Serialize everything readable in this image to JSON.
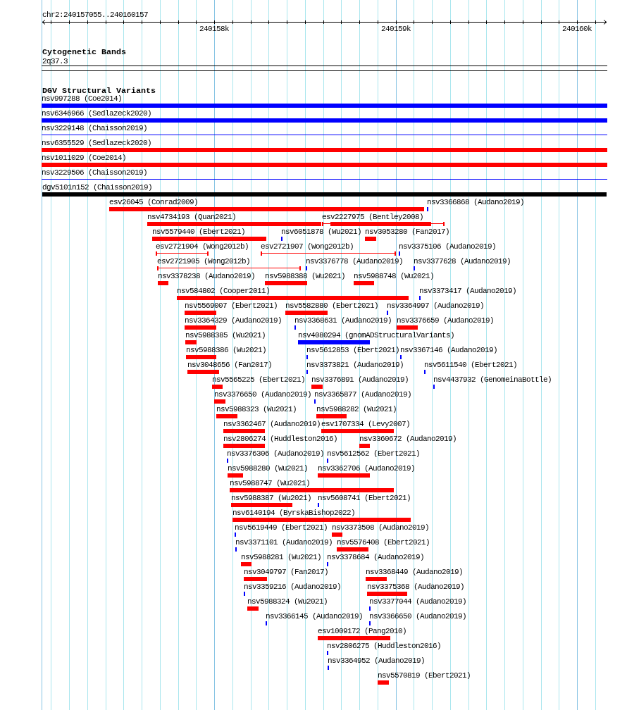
{
  "ruler": {
    "location": "chr2:240157055..240160157",
    "tick_labels": [
      "240158k",
      "240159k",
      "240160k"
    ]
  },
  "cytogenetic_bands": {
    "title": "Cytogenetic Bands",
    "band": "2q37.3"
  },
  "dgv": {
    "title": "DGV Structural Variants",
    "rows": [
      [
        {
          "label": "nsv997288 (Coe2014)",
          "kind": "bar",
          "color": "#0000ff"
        }
      ],
      [
        {
          "label": "nsv6346966 (Sedlazeck2020)",
          "kind": "bar",
          "color": "#0000ff"
        }
      ],
      [
        {
          "label": "nsv3229148 (Chaisson2019)",
          "kind": "line",
          "color": "#0000ff"
        }
      ],
      [
        {
          "label": "nsv6355529 (Sedlazeck2020)",
          "kind": "bar",
          "color": "#ff0000"
        }
      ],
      [
        {
          "label": "nsv1011029 (Coe2014)",
          "kind": "bar",
          "color": "#ff0000"
        }
      ],
      [
        {
          "label": "nsv3229506 (Chaisson2019)",
          "kind": "line",
          "color": "#0000ff"
        }
      ],
      [
        {
          "label": "dgv5101n152 (Chaisson2019)",
          "kind": "bar",
          "color": "#000000"
        }
      ],
      [
        {
          "label": "esv26045 (Conrad2009)",
          "kind": "bar",
          "color": "#ff0000"
        },
        {
          "label": "nsv3366868 (Audano2019)",
          "kind": "bar",
          "color": "#0000ff"
        }
      ],
      [
        {
          "label": "nsv4734193 (Quan2021)",
          "kind": "bar",
          "color": "#ff0000"
        },
        {
          "label": "esv2227975 (Bentley2008)",
          "kind": "mixed",
          "color": "#ff0000"
        }
      ],
      [
        {
          "label": "nsv5579440 (Ebert2021)",
          "kind": "bar",
          "color": "#ff0000"
        },
        {
          "label": "nsv6051878 (Wu2021)",
          "kind": "bar",
          "color": "#0000ff"
        },
        {
          "label": "nsv3053280 (Fan2017)",
          "kind": "bar",
          "color": "#ff0000"
        }
      ],
      [
        {
          "label": "esv2721904 (Wong2012b)",
          "kind": "interval",
          "color": "#ff0000"
        },
        {
          "label": "esv2721907 (Wong2012b)",
          "kind": "interval",
          "color": "#ff0000"
        },
        {
          "label": "nsv3375106 (Audano2019)",
          "kind": "bar",
          "color": "#0000ff"
        }
      ],
      [
        {
          "label": "esv2721905 (Wong2012b)",
          "kind": "interval",
          "color": "#ff0000"
        },
        {
          "label": "nsv3376778 (Audano2019)",
          "kind": "bar",
          "color": "#0000ff"
        },
        {
          "label": "nsv3377628 (Audano2019)",
          "kind": "bar",
          "color": "#0000ff"
        }
      ],
      [
        {
          "label": "nsv3378238 (Audano2019)",
          "kind": "bar",
          "color": "#ff0000"
        },
        {
          "label": "nsv5988388 (Wu2021)",
          "kind": "bar",
          "color": "#ff0000"
        },
        {
          "label": "nsv5988748 (Wu2021)",
          "kind": "bar",
          "color": "#ff0000"
        }
      ],
      [
        {
          "label": "nsv584802 (Cooper2011)",
          "kind": "bar",
          "color": "#ff0000"
        },
        {
          "label": "nsv3373417 (Audano2019)",
          "kind": "bar",
          "color": "#0000ff"
        }
      ],
      [
        {
          "label": "nsv5569007 (Ebert2021)",
          "kind": "bar",
          "color": "#ff0000"
        },
        {
          "label": "nsv5582880 (Ebert2021)",
          "kind": "bar",
          "color": "#ff0000"
        },
        {
          "label": "nsv3364997 (Audano2019)",
          "kind": "bar",
          "color": "#0000ff"
        }
      ],
      [
        {
          "label": "nsv3364329 (Audano2019)",
          "kind": "bar",
          "color": "#ff0000"
        },
        {
          "label": "nsv3368631 (Audano2019)",
          "kind": "bar",
          "color": "#0000ff"
        },
        {
          "label": "nsv3376659 (Audano2019)",
          "kind": "bar",
          "color": "#ff0000"
        }
      ],
      [
        {
          "label": "nsv5988385 (Wu2021)",
          "kind": "bar",
          "color": "#ff0000"
        },
        {
          "label": "nsv4080294 (gnomADStructuralVariants)",
          "kind": "bar",
          "color": "#0000ff"
        }
      ],
      [
        {
          "label": "nsv5988386 (Wu2021)",
          "kind": "bar",
          "color": "#ff0000"
        },
        {
          "label": "nsv5612853 (Ebert2021)",
          "kind": "bar",
          "color": "#0000ff"
        },
        {
          "label": "nsv3367146 (Audano2019)",
          "kind": "bar",
          "color": "#0000ff"
        }
      ],
      [
        {
          "label": "nsv3048656 (Fan2017)",
          "kind": "bar",
          "color": "#ff0000"
        },
        {
          "label": "nsv3373821 (Audano2019)",
          "kind": "bar",
          "color": "#0000ff"
        },
        {
          "label": "nsv5611540 (Ebert2021)",
          "kind": "bar",
          "color": "#0000ff"
        }
      ],
      [
        {
          "label": "nsv5565225 (Ebert2021)",
          "kind": "bar",
          "color": "#ff0000"
        },
        {
          "label": "nsv3376891 (Audano2019)",
          "kind": "bar",
          "color": "#ff0000"
        },
        {
          "label": "nsv4437932 (GenomeinaBottle)",
          "kind": "bar",
          "color": "#0000ff"
        }
      ],
      [
        {
          "label": "nsv3376650 (Audano2019)",
          "kind": "bar",
          "color": "#ff0000"
        },
        {
          "label": "nsv3365877 (Audano2019)",
          "kind": "bar",
          "color": "#0000ff"
        }
      ],
      [
        {
          "label": "nsv5988323 (Wu2021)",
          "kind": "bar",
          "color": "#ff0000"
        },
        {
          "label": "nsv5988282 (Wu2021)",
          "kind": "bar",
          "color": "#ff0000"
        }
      ],
      [
        {
          "label": "nsv3362467 (Audano2019)",
          "kind": "bar",
          "color": "#ff0000"
        },
        {
          "label": "esv1707334 (Levy2007)",
          "kind": "bar",
          "color": "#ff0000"
        }
      ],
      [
        {
          "label": "nsv2806274 (Huddleston2016)",
          "kind": "bar",
          "color": "#ff0000"
        },
        {
          "label": "nsv3360672 (Audano2019)",
          "kind": "bar",
          "color": "#ff0000"
        }
      ],
      [
        {
          "label": "nsv3376306 (Audano2019)",
          "kind": "bar",
          "color": "#0000ff"
        },
        {
          "label": "nsv5612562 (Ebert2021)",
          "kind": "bar",
          "color": "#0000ff"
        }
      ],
      [
        {
          "label": "nsv5988280 (Wu2021)",
          "kind": "bar",
          "color": "#ff0000"
        },
        {
          "label": "nsv3362706 (Audano2019)",
          "kind": "bar",
          "color": "#ff0000"
        }
      ],
      [
        {
          "label": "nsv5988747 (Wu2021)",
          "kind": "bar",
          "color": "#ff0000"
        }
      ],
      [
        {
          "label": "nsv5988387 (Wu2021)",
          "kind": "bar",
          "color": "#ff0000"
        },
        {
          "label": "nsv5608741 (Ebert2021)",
          "kind": "bar",
          "color": "#0000ff"
        }
      ],
      [
        {
          "label": "nsv6140194 (ByrskaBishop2022)",
          "kind": "bar",
          "color": "#ff0000"
        }
      ],
      [
        {
          "label": "nsv5619449 (Ebert2021)",
          "kind": "bar",
          "color": "#0000ff"
        },
        {
          "label": "nsv3373508 (Audano2019)",
          "kind": "bar",
          "color": "#ff0000"
        }
      ],
      [
        {
          "label": "nsv3371101 (Audano2019)",
          "kind": "bar",
          "color": "#0000ff"
        },
        {
          "label": "nsv5576408 (Ebert2021)",
          "kind": "bar",
          "color": "#ff0000"
        }
      ],
      [
        {
          "label": "nsv5988281 (Wu2021)",
          "kind": "bar",
          "color": "#ff0000"
        },
        {
          "label": "nsv3378684 (Audano2019)",
          "kind": "bar",
          "color": "#0000ff"
        }
      ],
      [
        {
          "label": "nsv3049797 (Fan2017)",
          "kind": "bar",
          "color": "#ff0000"
        },
        {
          "label": "nsv3368449 (Audano2019)",
          "kind": "bar",
          "color": "#ff0000"
        }
      ],
      [
        {
          "label": "nsv3359216 (Audano2019)",
          "kind": "bar",
          "color": "#0000ff"
        },
        {
          "label": "nsv3375368 (Audano2019)",
          "kind": "bar",
          "color": "#ff0000"
        }
      ],
      [
        {
          "label": "nsv5988324 (Wu2021)",
          "kind": "bar",
          "color": "#ff0000"
        },
        {
          "label": "nsv3377044 (Audano2019)",
          "kind": "bar",
          "color": "#0000ff"
        }
      ],
      [
        {
          "label": "nsv3366145 (Audano2019)",
          "kind": "bar",
          "color": "#0000ff"
        },
        {
          "label": "nsv3366650 (Audano2019)",
          "kind": "bar",
          "color": "#0000ff"
        }
      ],
      [
        {
          "label": "esv1009172 (Pang2010)",
          "kind": "bar",
          "color": "#ff0000"
        }
      ],
      [
        {
          "label": "nsv2806275 (Huddleston2016)",
          "kind": "bar",
          "color": "#0000ff"
        }
      ],
      [
        {
          "label": "nsv3364952 (Audano2019)",
          "kind": "bar",
          "color": "#0000ff"
        }
      ],
      [
        {
          "label": "nsv5570819 (Ebert2021)",
          "kind": "bar",
          "color": "#ff0000"
        }
      ]
    ]
  }
}
